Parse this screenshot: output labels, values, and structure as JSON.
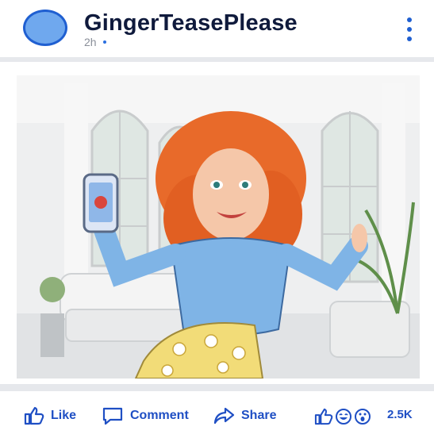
{
  "post": {
    "author": "GingerTeasePlease",
    "timestamp": "2h",
    "menu_icon": "more-vertical-icon",
    "image_alt_icon": "illustration"
  },
  "actions": {
    "like_label": "Like",
    "comment_label": "Comment",
    "share_label": "Share",
    "reaction_count": "2.5K",
    "reactions": [
      "thumbs-up-icon",
      "laughing-face-icon",
      "wow-face-icon"
    ]
  },
  "colors": {
    "accent": "#1f4fc4",
    "avatar_fill": "#6fa8ee",
    "divider": "#e6e8ec"
  }
}
